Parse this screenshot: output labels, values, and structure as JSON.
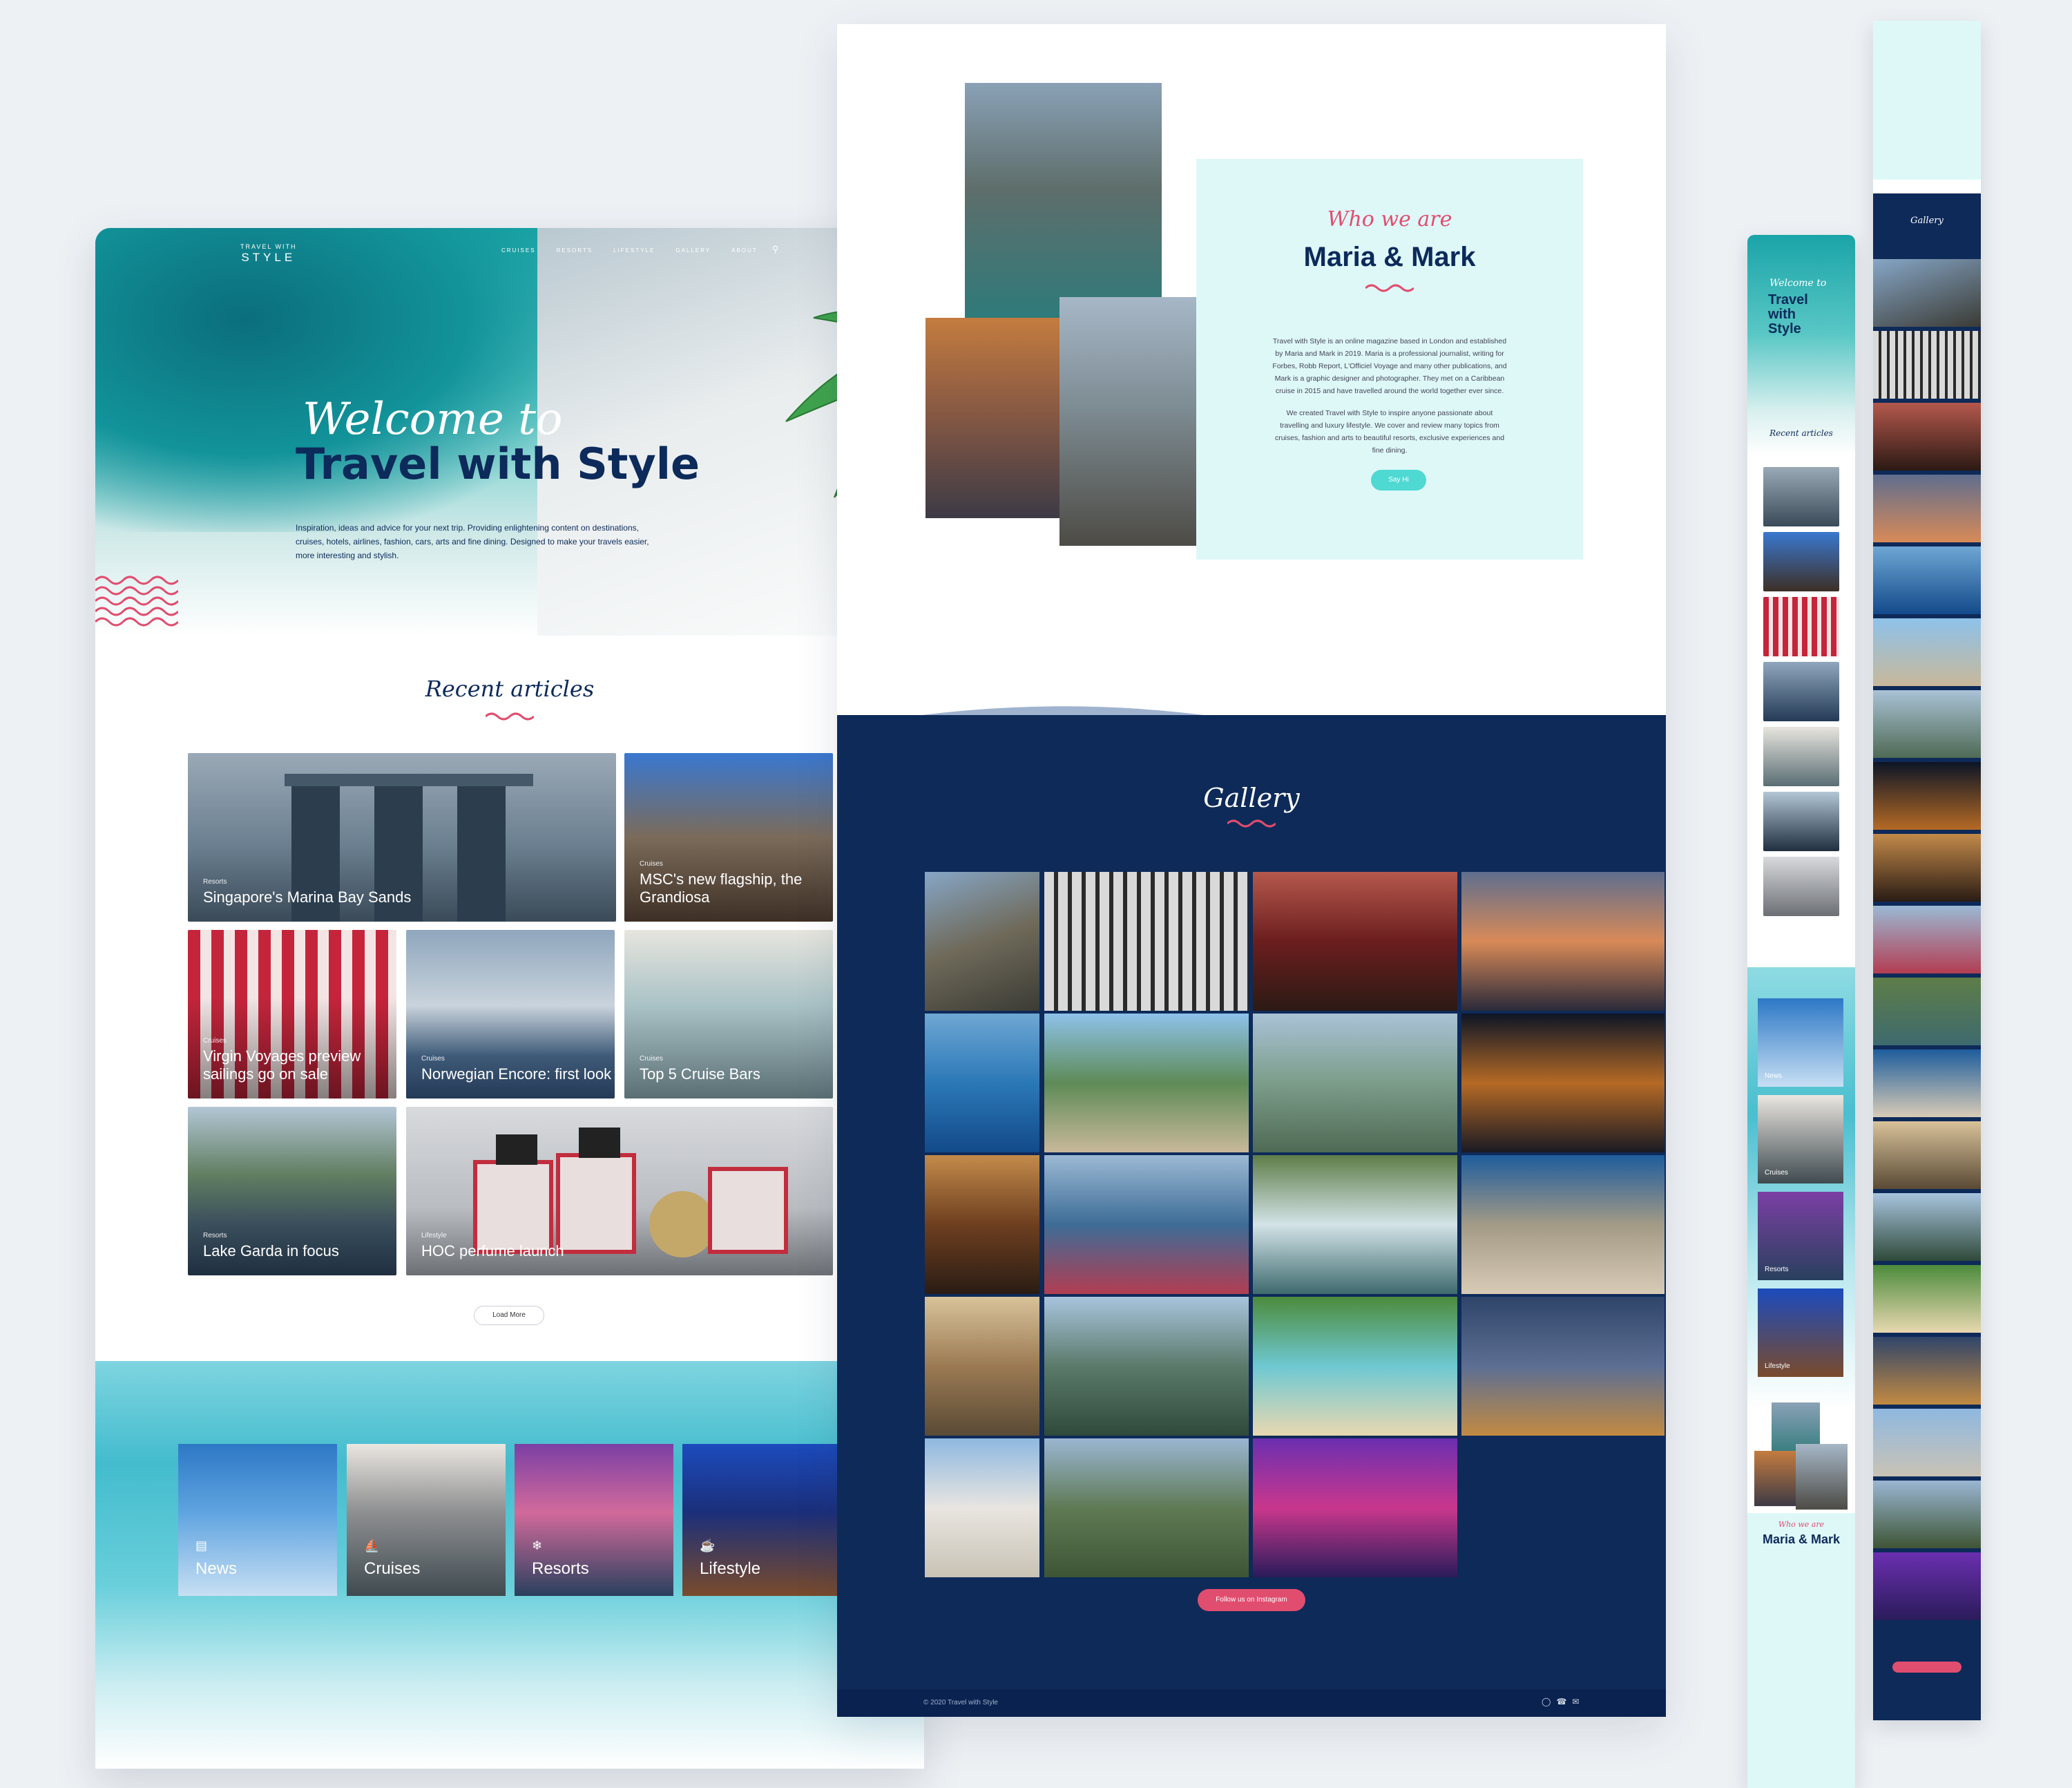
{
  "header": {
    "logo_top": "TRAVEL WITH",
    "logo_main": "STYLE",
    "nav": [
      "CRUISES",
      "RESORTS",
      "LIFESTYLE",
      "GALLERY",
      "ABOUT"
    ],
    "search_icon": "search-icon"
  },
  "hero": {
    "script_title": "Welcome to",
    "title": "Travel with Style",
    "text": "Inspiration, ideas and advice for your next trip. Providing enlightening content on destinations, cruises, hotels, airlines, fashion, cars, arts and fine dining. Designed to make your travels easier, more interesting and stylish."
  },
  "recent": {
    "title": "Recent articles",
    "articles": [
      {
        "category": "Resorts",
        "title": "Singapore's Marina Bay Sands"
      },
      {
        "category": "Cruises",
        "title": "MSC's new flagship, the Grandiosa"
      },
      {
        "category": "Cruises",
        "title": "Virgin Voyages preview sailings go on sale"
      },
      {
        "category": "Cruises",
        "title": "Norwegian Encore: first look"
      },
      {
        "category": "Cruises",
        "title": "Top 5 Cruise Bars"
      },
      {
        "category": "Resorts",
        "title": "Lake Garda in focus"
      },
      {
        "category": "Lifestyle",
        "title": "HOC perfume launch"
      }
    ],
    "load_more": "Load More"
  },
  "categories": [
    {
      "label": "News",
      "icon": "newspaper-icon"
    },
    {
      "label": "Cruises",
      "icon": "ship-icon"
    },
    {
      "label": "Resorts",
      "icon": "palm-icon"
    },
    {
      "label": "Lifestyle",
      "icon": "glass-icon"
    }
  ],
  "about": {
    "script_title": "Who we are",
    "title": "Maria & Mark",
    "p1": "Travel with Style is an online magazine based in London and established by Maria and Mark in 2019. Maria is a professional journalist, writing for Forbes, Robb Report, L'Officiel Voyage and many other publications, and Mark is a graphic designer and photographer. They met on a Caribbean cruise in 2015 and have travelled around the world together ever since.",
    "p2": "We created Travel with Style to inspire anyone passionate about travelling and luxury lifestyle. We cover and review many topics from cruises, fashion and arts to beautiful resorts, exclusive experiences and fine dining.",
    "button": "Say Hi"
  },
  "gallery": {
    "title": "Gallery",
    "button": "Follow us on Instagram"
  },
  "footer": {
    "copyright": "© 2020 Travel with Style",
    "icons": [
      "instagram-icon",
      "phone-icon",
      "mail-icon"
    ]
  },
  "mobile": {
    "hero_script": "Welcome to",
    "hero_title": "Travel with Style",
    "recent_title": "Recent articles",
    "about_script": "Who we are",
    "about_title": "Maria & Mark",
    "gallery_title": "Gallery"
  }
}
